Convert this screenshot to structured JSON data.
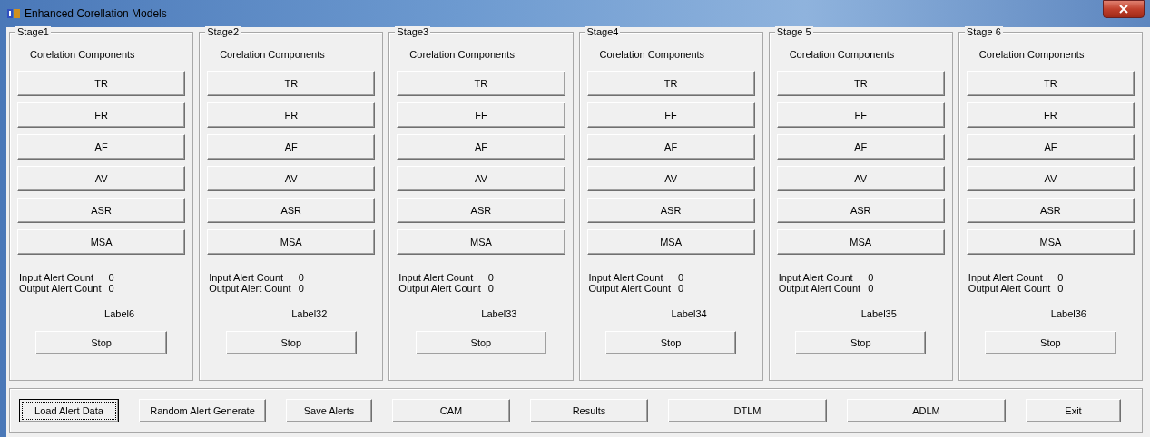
{
  "window": {
    "title": "Enhanced Corellation Models"
  },
  "stages": [
    {
      "title": "Stage1",
      "heading": "Corelation Components",
      "components": [
        "TR",
        "FR",
        "AF",
        "AV",
        "ASR",
        "MSA"
      ],
      "input_label": "Input Alert Count",
      "input_value": "0",
      "output_label": "Output Alert Count",
      "output_value": "0",
      "status": "Label6",
      "button": "Stop"
    },
    {
      "title": "Stage2",
      "heading": "Corelation Components",
      "components": [
        "TR",
        "FR",
        "AF",
        "AV",
        "ASR",
        "MSA"
      ],
      "input_label": "Input Alert Count",
      "input_value": "0",
      "output_label": "Output Alert Count",
      "output_value": "0",
      "status": "Label32",
      "button": "Stop"
    },
    {
      "title": "Stage3",
      "heading": "Corelation Components",
      "components": [
        "TR",
        "FF",
        "AF",
        "AV",
        "ASR",
        "MSA"
      ],
      "input_label": "Input Alert Count",
      "input_value": "0",
      "output_label": "Output Alert Count",
      "output_value": "0",
      "status": "Label33",
      "button": "Stop"
    },
    {
      "title": "Stage4",
      "heading": "Corelation Components",
      "components": [
        "TR",
        "FF",
        "AF",
        "AV",
        "ASR",
        "MSA"
      ],
      "input_label": "Input Alert Count",
      "input_value": "0",
      "output_label": "Output Alert Count",
      "output_value": "0",
      "status": "Label34",
      "button": "Stop"
    },
    {
      "title": "Stage 5",
      "heading": "Corelation Components",
      "components": [
        "TR",
        "FF",
        "AF",
        "AV",
        "ASR",
        "MSA"
      ],
      "input_label": "Input Alert Count",
      "input_value": "0",
      "output_label": "Output Alert Count",
      "output_value": "0",
      "status": "Label35",
      "button": "Stop"
    },
    {
      "title": "Stage 6",
      "heading": "Corelation Components",
      "components": [
        "TR",
        "FR",
        "AF",
        "AV",
        "ASR",
        "MSA"
      ],
      "input_label": "Input Alert Count",
      "input_value": "0",
      "output_label": "Output Alert Count",
      "output_value": "0",
      "status": "Label36",
      "button": "Stop"
    }
  ],
  "buttons": [
    {
      "label": "Load Alert Data",
      "focused": true
    },
    {
      "label": "Random Alert Generate",
      "focused": false
    },
    {
      "label": "Save Alerts",
      "focused": false
    },
    {
      "label": "CAM",
      "focused": false
    },
    {
      "label": "Results",
      "focused": false
    },
    {
      "label": "DTLM",
      "focused": false
    },
    {
      "label": "ADLM",
      "focused": false
    },
    {
      "label": "Exit",
      "focused": false
    }
  ]
}
